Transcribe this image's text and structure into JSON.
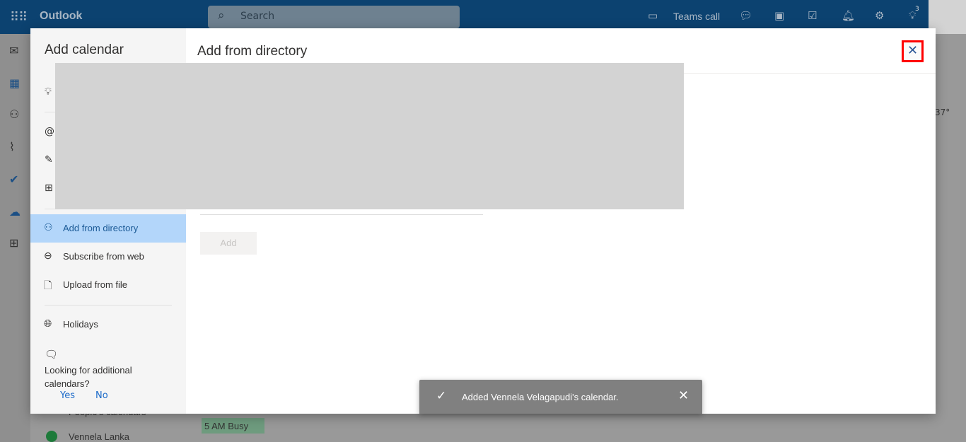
{
  "header": {
    "app_name": "Outlook",
    "search_placeholder": "Search",
    "teams_call": "Teams call",
    "tips_badge": "3"
  },
  "modal": {
    "nav_title": "Add calendar",
    "nav_items": [
      {
        "label": "Add from directory",
        "icon": "people-add-icon",
        "selected": true
      },
      {
        "label": "Subscribe from web",
        "icon": "link-icon"
      },
      {
        "label": "Upload from file",
        "icon": "file-upload-icon"
      },
      {
        "label": "Holidays",
        "icon": "globe-icon"
      }
    ],
    "prompt": {
      "text": "Looking for additional calendars?",
      "yes": "Yes",
      "no": "No"
    },
    "main_title": "Add from directory",
    "add_button": "Add"
  },
  "toast": {
    "message": "Added Vennela Velagapudi's calendar."
  },
  "background": {
    "people_calendars": "People's calendars",
    "calendar_owner": "Vennela Lanka",
    "busy_event": "5 AM Busy",
    "weather": "37°",
    "accent": "#0c4270",
    "selected_color": "#b3d6fa",
    "close_highlight": "#ff0000"
  }
}
